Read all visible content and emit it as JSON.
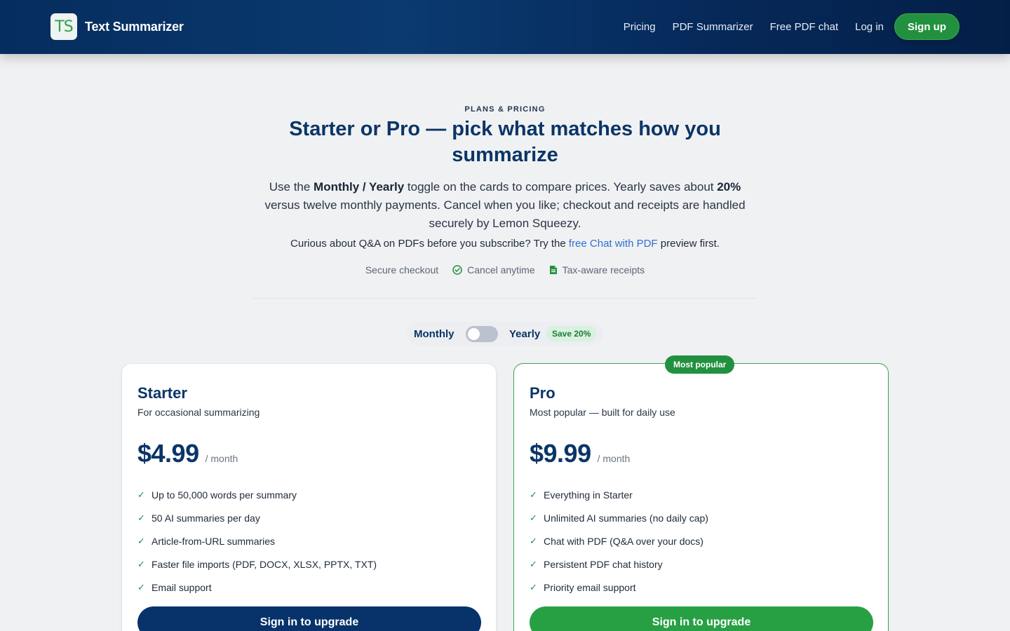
{
  "header": {
    "logo_text": "TS",
    "app_name": "Text Summarizer",
    "nav": [
      {
        "label": "Pricing"
      },
      {
        "label": "PDF Summarizer"
      },
      {
        "label": "Free PDF chat"
      },
      {
        "label": "Log in"
      }
    ],
    "signup_label": "Sign up"
  },
  "intro": {
    "eyebrow": "PLANS & PRICING",
    "headline": "Starter or Pro — pick what matches how you summarize",
    "lead_1": "Use the ",
    "lead_bold_1": "Monthly / Yearly",
    "lead_2": " toggle on the cards to compare prices. Yearly saves about ",
    "lead_bold_2": "20%",
    "lead_3": " versus twelve monthly payments. Cancel when you like; checkout and receipts are handled securely by Lemon Squeezy.",
    "curious_1": "Curious about Q&A on PDFs before you subscribe? Try the ",
    "curious_link": "free Chat with PDF",
    "curious_2": " preview first.",
    "trust": [
      {
        "label": "Secure checkout",
        "icon": ""
      },
      {
        "label": "Cancel anytime",
        "icon": "check-circle-icon"
      },
      {
        "label": "Tax-aware receipts",
        "icon": "document-icon"
      }
    ]
  },
  "billing_toggle": {
    "monthly_label": "Monthly",
    "yearly_label": "Yearly",
    "save_badge": "Save 20%",
    "selected": "Monthly"
  },
  "plans": [
    {
      "name": "Starter",
      "subtitle": "For occasional summarizing",
      "price": "$4.99",
      "period": "/ month",
      "features": [
        "Up to 50,000 words per summary",
        "50 AI summaries per day",
        "Article-from-URL summaries",
        "Faster file imports (PDF, DOCX, XLSX, PPTX, TXT)",
        "Email support"
      ],
      "cta": "Sign in to upgrade"
    },
    {
      "name": "Pro",
      "badge": "Most popular",
      "subtitle": "Most popular — built for daily use",
      "price": "$9.99",
      "period": "/ month",
      "features": [
        "Everything in Starter",
        "Unlimited AI summaries (no daily cap)",
        "Chat with PDF (Q&A over your docs)",
        "Persistent PDF chat history",
        "Priority email support"
      ],
      "cta": "Sign in to upgrade"
    }
  ],
  "colors": {
    "brand_navy": "#0b3566",
    "accent_green": "#22913f",
    "link_blue": "#2f6fd1"
  }
}
